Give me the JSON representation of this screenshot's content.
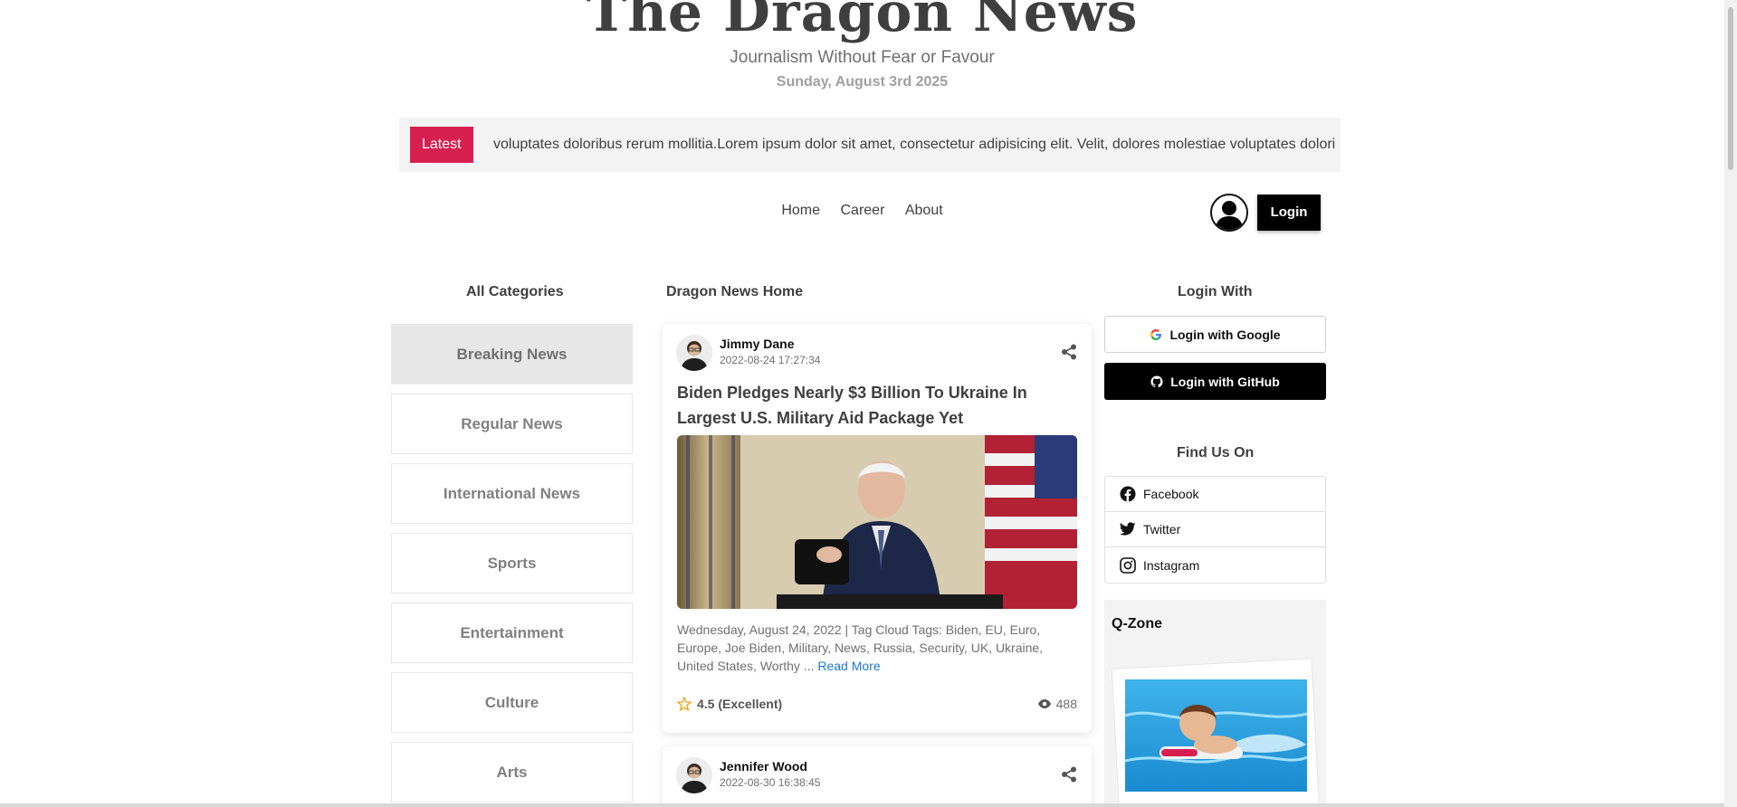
{
  "header": {
    "logo_text": "The Dragon News",
    "tagline": "Journalism Without Fear or Favour",
    "date": "Sunday, August 3rd 2025"
  },
  "ticker": {
    "badge": "Latest",
    "text": "voluptates doloribus rerum mollitia.Lorem ipsum dolor sit amet, consectetur adipisicing elit. Velit, dolores molestiae voluptates dolori"
  },
  "nav": {
    "items": [
      "Home",
      "Career",
      "About"
    ],
    "login_label": "Login"
  },
  "left": {
    "title": "All Categories",
    "categories": [
      "Breaking News",
      "Regular News",
      "International News",
      "Sports",
      "Entertainment",
      "Culture",
      "Arts"
    ]
  },
  "center": {
    "title": "Dragon News Home",
    "articles": [
      {
        "author": "Jimmy Dane",
        "published": "2022-08-24 17:27:34",
        "title": "Biden Pledges Nearly $3 Billion To Ukraine In Largest U.S. Military Aid Package Yet",
        "excerpt": "Wednesday, August 24, 2022 | Tag Cloud Tags: Biden, EU, Euro, Europe, Joe Biden, Military, News, Russia, Security, UK, Ukraine, United States, Worthy ...",
        "read_more": "Read More",
        "rating": "4.5 (Excellent)",
        "views": "488"
      },
      {
        "author": "Jennifer Wood",
        "published": "2022-08-30 16:38:45"
      }
    ]
  },
  "right": {
    "login_title": "Login With",
    "google_label": "Login with Google",
    "github_label": "Login with GitHub",
    "find_title": "Find Us On",
    "social": [
      "Facebook",
      "Twitter",
      "Instagram"
    ],
    "qzone_title": "Q-Zone"
  },
  "colors": {
    "accent": "#d72050",
    "link": "#1f78d1",
    "muted": "#706f6f"
  }
}
